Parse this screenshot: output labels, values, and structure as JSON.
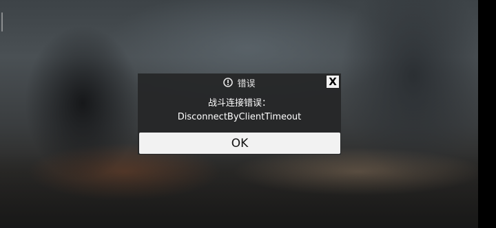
{
  "dialog": {
    "title": "错误",
    "title_icon": "alert-circle-icon",
    "close_label": "X",
    "message_line1": "战斗连接错误：",
    "message_line2": "DisconnectByClientTimeout",
    "ok_label": "OK"
  },
  "colors": {
    "dialog_bg": "#262728",
    "button_bg": "#f2f2f2",
    "text": "#ffffff"
  }
}
